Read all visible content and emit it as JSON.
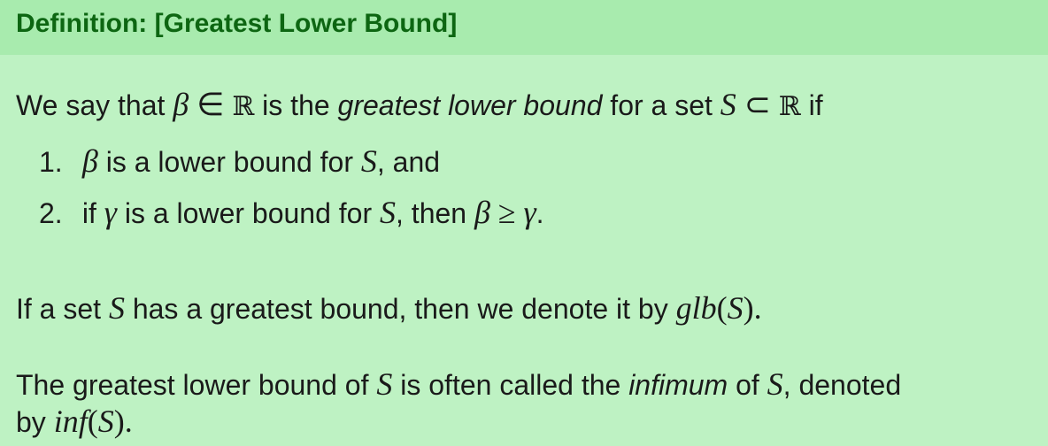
{
  "title": "Definition: [Greatest Lower Bound]",
  "line1": {
    "a": "We say that",
    "beta": "β",
    "in": "∈",
    "R1": "ℝ",
    "b": "is the",
    "emph": "greatest lower bound",
    "c": "for a set",
    "S": "S",
    "subset": "⊂",
    "R2": "ℝ",
    "d": "if"
  },
  "items": [
    {
      "num": "1.",
      "beta": "β",
      "a": "is a lower bound for",
      "S": "S",
      "b": ", and"
    },
    {
      "num": "2.",
      "a": "if",
      "gamma": "γ",
      "b": "is a lower bound for",
      "S": "S",
      "c": ",  then",
      "beta": "β",
      "ge": "≥",
      "gamma2": "γ",
      "end": "."
    }
  ],
  "line3": {
    "a": "If a set",
    "S": "S",
    "b": "has a greatest bound, then we denote it by",
    "glb": "glb",
    "open": "(",
    "S2": "S",
    "close": ").",
    "end": ""
  },
  "line4": {
    "a": "The greatest lower bound of",
    "S": "S",
    "b": "is often called the",
    "emph": "infimum",
    "c": "of",
    "S2": "S",
    "d": ", denoted"
  },
  "line5": {
    "a": "by",
    "inf": "inf",
    "open": "(",
    "S": "S",
    "close": ")."
  }
}
